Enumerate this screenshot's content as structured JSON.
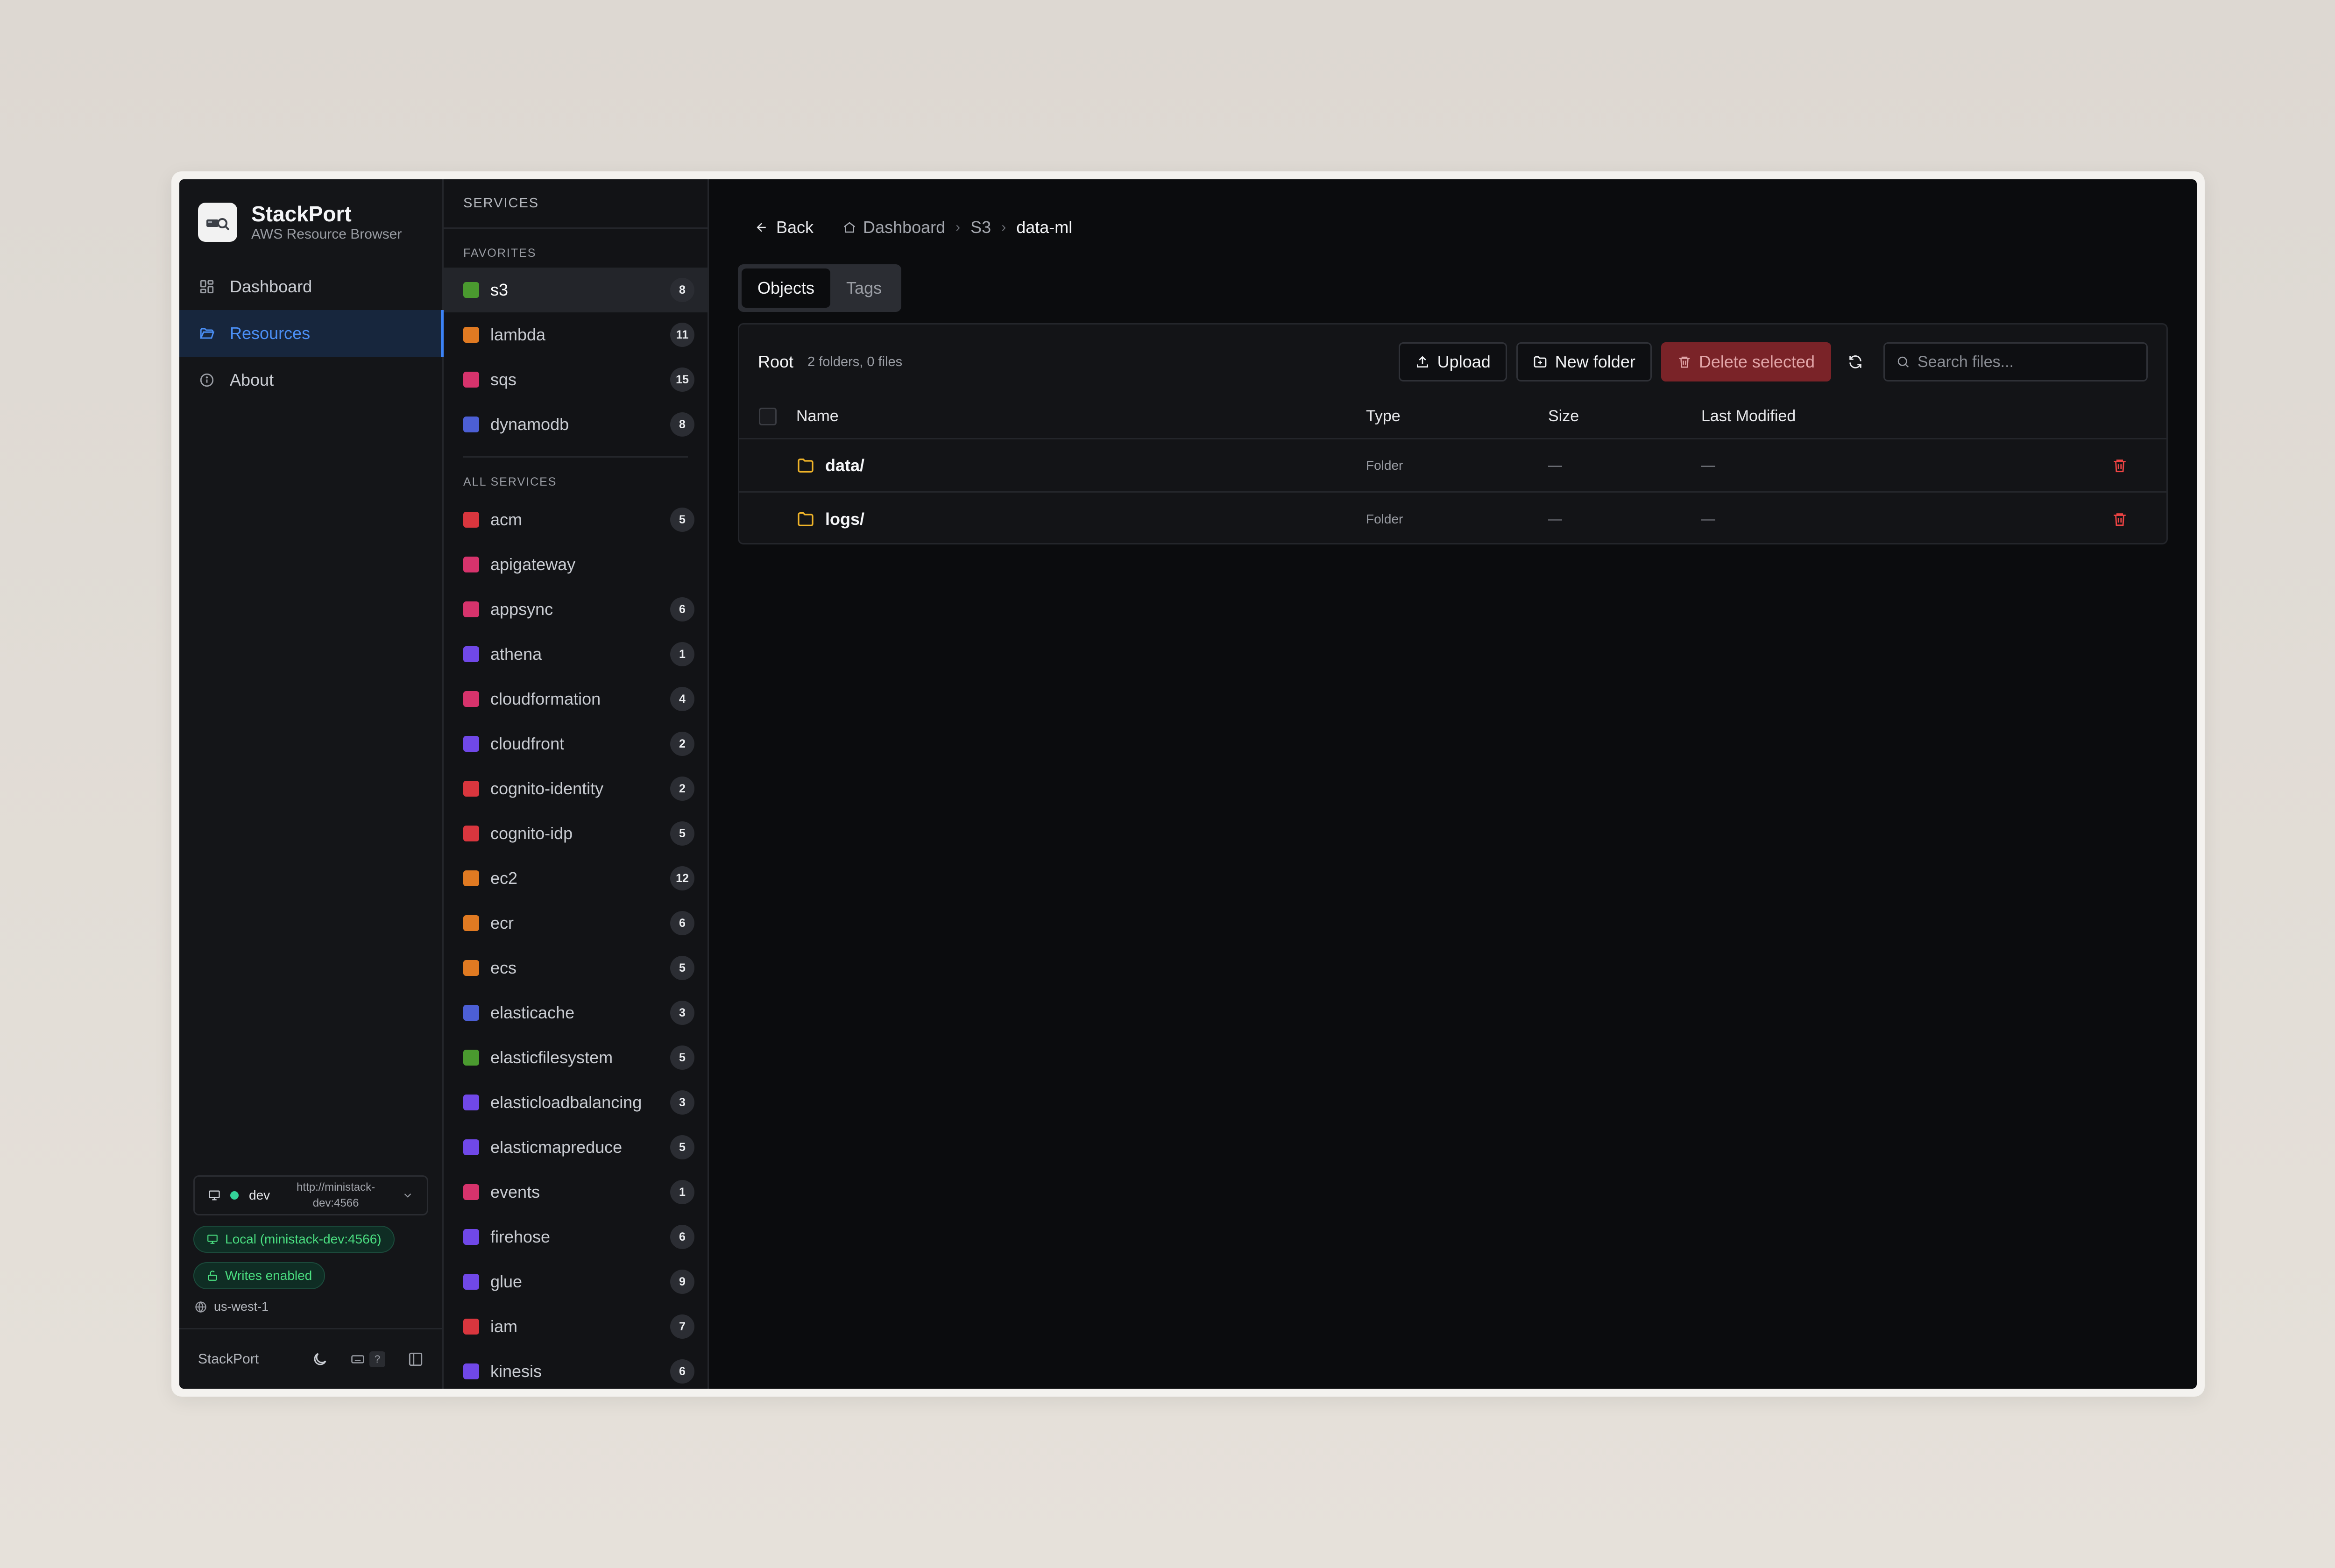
{
  "brand": {
    "title": "StackPort",
    "subtitle": "AWS Resource Browser"
  },
  "nav": {
    "items": [
      {
        "label": "Dashboard",
        "icon": "grid-icon"
      },
      {
        "label": "Resources",
        "icon": "folder-open-icon",
        "active": true
      },
      {
        "label": "About",
        "icon": "info-icon"
      }
    ]
  },
  "environment": {
    "name": "dev",
    "url": "http://ministack-dev:4566",
    "connection_label": "Local (ministack-dev:4566)",
    "writes_label": "Writes enabled",
    "region": "us-west-1"
  },
  "footer": {
    "label": "StackPort",
    "help_key": "?"
  },
  "services": {
    "header": "SERVICES",
    "favorites_label": "FAVORITES",
    "all_label": "ALL SERVICES",
    "favorites": [
      {
        "name": "s3",
        "count": "8",
        "color": "#4a9a2f",
        "active": true
      },
      {
        "name": "lambda",
        "count": "11",
        "color": "#e07a22"
      },
      {
        "name": "sqs",
        "count": "15",
        "color": "#d6336c"
      },
      {
        "name": "dynamodb",
        "count": "8",
        "color": "#4c5fd5"
      }
    ],
    "all": [
      {
        "name": "acm",
        "count": "5",
        "color": "#d9363e"
      },
      {
        "name": "apigateway",
        "count": "",
        "color": "#d6336c"
      },
      {
        "name": "appsync",
        "count": "6",
        "color": "#d6336c"
      },
      {
        "name": "athena",
        "count": "1",
        "color": "#7048e8"
      },
      {
        "name": "cloudformation",
        "count": "4",
        "color": "#d6336c"
      },
      {
        "name": "cloudfront",
        "count": "2",
        "color": "#7048e8"
      },
      {
        "name": "cognito-identity",
        "count": "2",
        "color": "#d9363e"
      },
      {
        "name": "cognito-idp",
        "count": "5",
        "color": "#d9363e"
      },
      {
        "name": "ec2",
        "count": "12",
        "color": "#e07a22"
      },
      {
        "name": "ecr",
        "count": "6",
        "color": "#e07a22"
      },
      {
        "name": "ecs",
        "count": "5",
        "color": "#e07a22"
      },
      {
        "name": "elasticache",
        "count": "3",
        "color": "#4c5fd5"
      },
      {
        "name": "elasticfilesystem",
        "count": "5",
        "color": "#4a9a2f"
      },
      {
        "name": "elasticloadbalancing",
        "count": "3",
        "color": "#7048e8"
      },
      {
        "name": "elasticmapreduce",
        "count": "5",
        "color": "#7048e8"
      },
      {
        "name": "events",
        "count": "1",
        "color": "#d6336c"
      },
      {
        "name": "firehose",
        "count": "6",
        "color": "#7048e8"
      },
      {
        "name": "glue",
        "count": "9",
        "color": "#7048e8"
      },
      {
        "name": "iam",
        "count": "7",
        "color": "#d9363e"
      },
      {
        "name": "kinesis",
        "count": "6",
        "color": "#7048e8"
      }
    ]
  },
  "breadcrumb": {
    "back": "Back",
    "items": [
      "Dashboard",
      "S3",
      "data-ml"
    ]
  },
  "tabs": [
    {
      "label": "Objects",
      "active": true
    },
    {
      "label": "Tags"
    }
  ],
  "browser": {
    "root_label": "Root",
    "summary": "2 folders, 0 files",
    "upload_label": "Upload",
    "new_folder_label": "New folder",
    "delete_label": "Delete selected",
    "search_placeholder": "Search files...",
    "columns": {
      "name": "Name",
      "type": "Type",
      "size": "Size",
      "modified": "Last Modified"
    },
    "rows": [
      {
        "name": "data/",
        "type": "Folder",
        "size": "—",
        "modified": "—"
      },
      {
        "name": "logs/",
        "type": "Folder",
        "size": "—",
        "modified": "—"
      }
    ]
  }
}
